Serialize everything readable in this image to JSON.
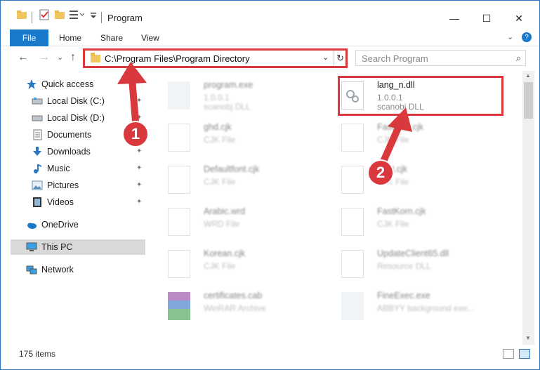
{
  "window": {
    "title": "Program",
    "controls": {
      "minimize": "—",
      "maximize": "☐",
      "close": "✕"
    }
  },
  "ribbon": {
    "tabs": [
      "File",
      "Home",
      "Share",
      "View"
    ],
    "collapse": "⌄",
    "help": "?"
  },
  "address": {
    "back": "←",
    "forward": "→",
    "recent": "⌄",
    "up": "↑",
    "path": "C:\\Program Files\\Program Directory",
    "dropdown": "⌄",
    "refresh": "↻",
    "search_placeholder": "Search Program",
    "search_icon": "⌕"
  },
  "nav_pane": {
    "items": [
      {
        "label": "Quick access",
        "icon": "star-icon"
      },
      {
        "label": "Local Disk (C:)",
        "icon": "drive-icon"
      },
      {
        "label": "Local Disk (D:)",
        "icon": "drive-icon"
      },
      {
        "label": "Documents",
        "icon": "documents-icon"
      },
      {
        "label": "Downloads",
        "icon": "download-icon"
      },
      {
        "label": "Music",
        "icon": "music-icon"
      },
      {
        "label": "Pictures",
        "icon": "pictures-icon"
      },
      {
        "label": "Videos",
        "icon": "videos-icon"
      },
      {
        "label": "OneDrive",
        "icon": "cloud-icon"
      },
      {
        "label": "This PC",
        "icon": "computer-icon"
      },
      {
        "label": "Network",
        "icon": "network-icon"
      }
    ],
    "pin": "📌"
  },
  "files": {
    "left": [
      {
        "name": "program.exe",
        "sub1": "1.0.0.1",
        "sub2": "scanobj DLL"
      },
      {
        "name": "ghd.cjk",
        "sub1": "CJK File",
        "sub2": ""
      },
      {
        "name": "Defaultfont.cjk",
        "sub1": "CJK File",
        "sub2": ""
      },
      {
        "name": "Arabic.wrd",
        "sub1": "WRD File",
        "sub2": ""
      },
      {
        "name": "Korean.cjk",
        "sub1": "CJK File",
        "sub2": ""
      },
      {
        "name": "certificates.cab",
        "sub1": "WinRAR Archive",
        "sub2": ""
      }
    ],
    "right": [
      {
        "name": "lang_n.dll",
        "sub1": "1.0.0.1",
        "sub2": "scanobj DLL"
      },
      {
        "name": "FastHeb.cjk",
        "sub1": "CJK File",
        "sub2": ""
      },
      {
        "name": "Fast.cjk",
        "sub1": "CJK File",
        "sub2": ""
      },
      {
        "name": "FastKorn.cjk",
        "sub1": "CJK File",
        "sub2": ""
      },
      {
        "name": "UpdateClient65.dll",
        "sub1": "Resource DLL",
        "sub2": ""
      },
      {
        "name": "FineExec.exe",
        "sub1": "ABBYY background exe...",
        "sub2": ""
      }
    ]
  },
  "status": {
    "items_count": "175 items"
  },
  "callouts": {
    "one": "1",
    "two": "2"
  },
  "colors": {
    "accent": "#1979ca",
    "highlight": "#d9383d"
  }
}
